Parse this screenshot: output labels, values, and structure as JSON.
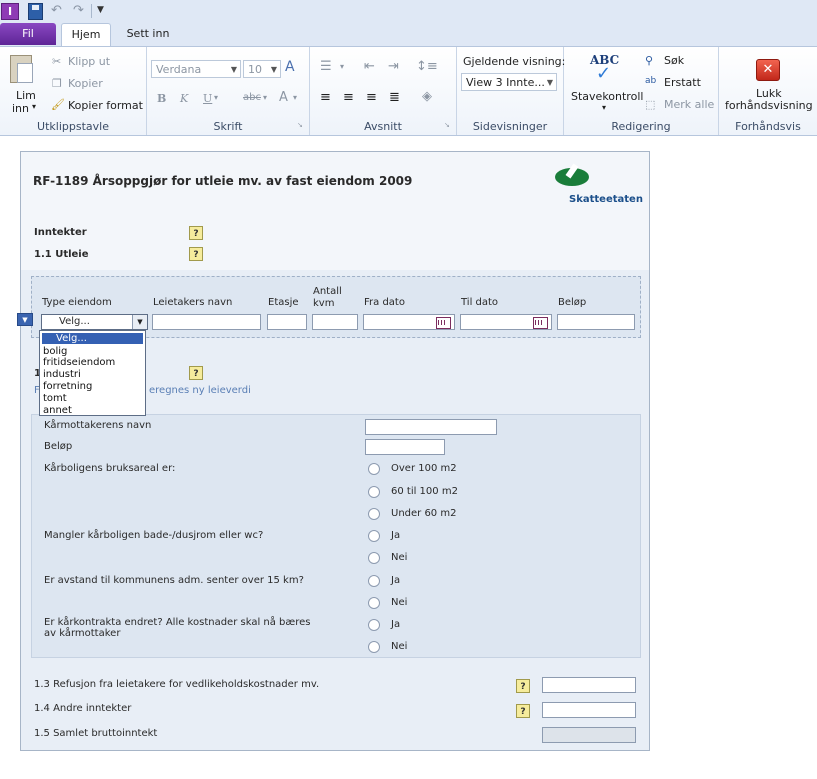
{
  "qat": {
    "app_letter": "I"
  },
  "tabs": {
    "fil": "Fil",
    "hjem": "Hjem",
    "sett_inn": "Sett inn"
  },
  "ribbon": {
    "clipboard": {
      "paste_line1": "Lim",
      "paste_line2": "inn",
      "cut": "Klipp ut",
      "copy": "Kopier",
      "format_painter": "Kopier format",
      "label": "Utklippstavle"
    },
    "font": {
      "family": "Verdana",
      "size": "10",
      "bold": "B",
      "italic": "K",
      "underline": "U",
      "strike": "abc",
      "color_a": "A",
      "label": "Skrift"
    },
    "paragraph": {
      "label": "Avsnitt"
    },
    "views": {
      "title": "Gjeldende visning:",
      "current": "View 3 Innte...",
      "label": "Sidevisninger"
    },
    "editing": {
      "spell_abc": "ABC",
      "spellcheck": "Stavekontroll",
      "find": "Søk",
      "replace": "Erstatt",
      "select_all": "Merk alle",
      "label": "Redigering"
    },
    "preview": {
      "close_line1": "Lukk",
      "close_line2": "forhåndsvisning",
      "label": "Forhåndsvis"
    }
  },
  "form": {
    "title": "RF-1189 Årsoppgjør for utleie mv. av fast eiendom 2009",
    "logo_text": "Skatteetaten",
    "inntekter": "Inntekter",
    "utleie": "1.1 Utleie",
    "columns": {
      "type": "Type eiendom",
      "tenant": "Leietakers navn",
      "floor": "Etasje",
      "area_line1": "Antall",
      "area_line2": "kvm",
      "from": "Fra dato",
      "to": "Til dato",
      "amount": "Beløp"
    },
    "select_value": "Velg...",
    "dropdown_options": [
      "Velg...",
      "bolig",
      "fritidseiendom",
      "industri",
      "forretning",
      "tomt",
      "annet"
    ],
    "section_12_prefix": "1",
    "section_12_sub_prefix": "F",
    "section_12_sub_suffix": "eregnes ny leieverdi",
    "kar": {
      "name_label": "Kårmottakerens navn",
      "amount_label": "Beløp",
      "area_question": "Kårboligens bruksareal er:",
      "area_options": [
        "Over 100 m2",
        "60 til 100 m2",
        "Under 60 m2"
      ],
      "bath_question": "Mangler kårboligen bade-/dusjrom eller wc?",
      "bath_options": [
        "Ja",
        "Nei"
      ],
      "distance_question": "Er avstand til kommunens adm. senter over 15 km?",
      "distance_options": [
        "Ja",
        "Nei"
      ],
      "contract_question_line1": "Er kårkontrakta endret? Alle kostnader skal nå bæres",
      "contract_question_line2": "av kårmottaker",
      "contract_options": [
        "Ja",
        "Nei"
      ]
    },
    "refund_label": "1.3 Refusjon fra leietakere for vedlikeholdskostnader mv.",
    "other_income_label": "1.4 Andre inntekter",
    "gross_income_label": "1.5 Samlet bruttoinntekt"
  },
  "colors": {
    "accent_purple": "#5e2596",
    "brand_green": "#1a7d3a",
    "form_bg": "#e8eef6",
    "selection": "#3460b3"
  }
}
